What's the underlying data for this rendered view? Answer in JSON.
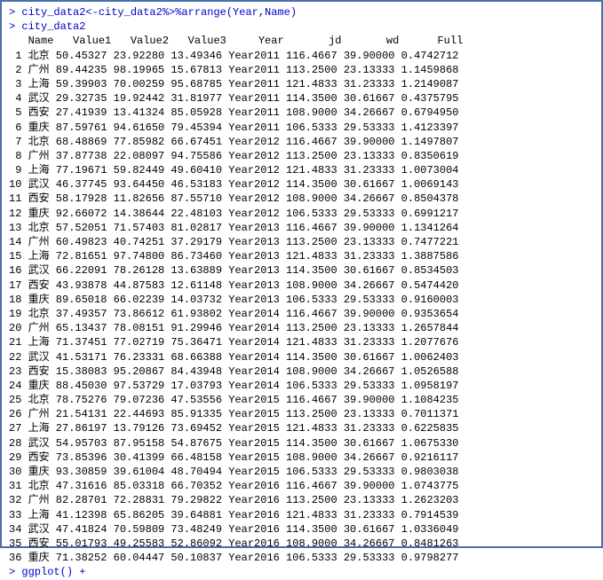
{
  "console": {
    "prompt": "> ",
    "line1": "city_data2<-city_data2%>%arrange(Year,Name)",
    "line2": "city_data2",
    "line3": "ggplot() +"
  },
  "chart_data": {
    "type": "table",
    "columns": [
      "Name",
      "Value1",
      "Value2",
      "Value3",
      "Year",
      "jd",
      "wd",
      "Full"
    ],
    "rows": [
      {
        "idx": 1,
        "Name": "北京",
        "Value1": "50.45327",
        "Value2": "23.92280",
        "Value3": "13.49346",
        "Year": "Year2011",
        "jd": "116.4667",
        "wd": "39.90000",
        "Full": "0.4742712"
      },
      {
        "idx": 2,
        "Name": "广州",
        "Value1": "89.44235",
        "Value2": "98.19965",
        "Value3": "15.67813",
        "Year": "Year2011",
        "jd": "113.2500",
        "wd": "23.13333",
        "Full": "1.1459868"
      },
      {
        "idx": 3,
        "Name": "上海",
        "Value1": "59.39903",
        "Value2": "70.00259",
        "Value3": "95.68785",
        "Year": "Year2011",
        "jd": "121.4833",
        "wd": "31.23333",
        "Full": "1.2149087"
      },
      {
        "idx": 4,
        "Name": "武汉",
        "Value1": "29.32735",
        "Value2": "19.92442",
        "Value3": "31.81977",
        "Year": "Year2011",
        "jd": "114.3500",
        "wd": "30.61667",
        "Full": "0.4375795"
      },
      {
        "idx": 5,
        "Name": "西安",
        "Value1": "27.41939",
        "Value2": "13.41324",
        "Value3": "85.05928",
        "Year": "Year2011",
        "jd": "108.9000",
        "wd": "34.26667",
        "Full": "0.6794950"
      },
      {
        "idx": 6,
        "Name": "重庆",
        "Value1": "87.59761",
        "Value2": "94.61650",
        "Value3": "79.45394",
        "Year": "Year2011",
        "jd": "106.5333",
        "wd": "29.53333",
        "Full": "1.4123397"
      },
      {
        "idx": 7,
        "Name": "北京",
        "Value1": "68.48869",
        "Value2": "77.85982",
        "Value3": "66.67451",
        "Year": "Year2012",
        "jd": "116.4667",
        "wd": "39.90000",
        "Full": "1.1497807"
      },
      {
        "idx": 8,
        "Name": "广州",
        "Value1": "37.87738",
        "Value2": "22.08097",
        "Value3": "94.75586",
        "Year": "Year2012",
        "jd": "113.2500",
        "wd": "23.13333",
        "Full": "0.8350619"
      },
      {
        "idx": 9,
        "Name": "上海",
        "Value1": "77.19671",
        "Value2": "59.82449",
        "Value3": "49.60410",
        "Year": "Year2012",
        "jd": "121.4833",
        "wd": "31.23333",
        "Full": "1.0073004"
      },
      {
        "idx": 10,
        "Name": "武汉",
        "Value1": "46.37745",
        "Value2": "93.64450",
        "Value3": "46.53183",
        "Year": "Year2012",
        "jd": "114.3500",
        "wd": "30.61667",
        "Full": "1.0069143"
      },
      {
        "idx": 11,
        "Name": "西安",
        "Value1": "58.17928",
        "Value2": "11.82656",
        "Value3": "87.55710",
        "Year": "Year2012",
        "jd": "108.9000",
        "wd": "34.26667",
        "Full": "0.8504378"
      },
      {
        "idx": 12,
        "Name": "重庆",
        "Value1": "92.66072",
        "Value2": "14.38644",
        "Value3": "22.48103",
        "Year": "Year2012",
        "jd": "106.5333",
        "wd": "29.53333",
        "Full": "0.6991217"
      },
      {
        "idx": 13,
        "Name": "北京",
        "Value1": "57.52051",
        "Value2": "71.57403",
        "Value3": "81.02817",
        "Year": "Year2013",
        "jd": "116.4667",
        "wd": "39.90000",
        "Full": "1.1341264"
      },
      {
        "idx": 14,
        "Name": "广州",
        "Value1": "60.49823",
        "Value2": "40.74251",
        "Value3": "37.29179",
        "Year": "Year2013",
        "jd": "113.2500",
        "wd": "23.13333",
        "Full": "0.7477221"
      },
      {
        "idx": 15,
        "Name": "上海",
        "Value1": "72.81651",
        "Value2": "97.74800",
        "Value3": "86.73460",
        "Year": "Year2013",
        "jd": "121.4833",
        "wd": "31.23333",
        "Full": "1.3887586"
      },
      {
        "idx": 16,
        "Name": "武汉",
        "Value1": "66.22091",
        "Value2": "78.26128",
        "Value3": "13.63889",
        "Year": "Year2013",
        "jd": "114.3500",
        "wd": "30.61667",
        "Full": "0.8534503"
      },
      {
        "idx": 17,
        "Name": "西安",
        "Value1": "43.93878",
        "Value2": "44.87583",
        "Value3": "12.61148",
        "Year": "Year2013",
        "jd": "108.9000",
        "wd": "34.26667",
        "Full": "0.5474420"
      },
      {
        "idx": 18,
        "Name": "重庆",
        "Value1": "89.65018",
        "Value2": "66.02239",
        "Value3": "14.03732",
        "Year": "Year2013",
        "jd": "106.5333",
        "wd": "29.53333",
        "Full": "0.9160003"
      },
      {
        "idx": 19,
        "Name": "北京",
        "Value1": "37.49357",
        "Value2": "73.86612",
        "Value3": "61.93802",
        "Year": "Year2014",
        "jd": "116.4667",
        "wd": "39.90000",
        "Full": "0.9353654"
      },
      {
        "idx": 20,
        "Name": "广州",
        "Value1": "65.13437",
        "Value2": "78.08151",
        "Value3": "91.29946",
        "Year": "Year2014",
        "jd": "113.2500",
        "wd": "23.13333",
        "Full": "1.2657844"
      },
      {
        "idx": 21,
        "Name": "上海",
        "Value1": "71.37451",
        "Value2": "77.02719",
        "Value3": "75.36471",
        "Year": "Year2014",
        "jd": "121.4833",
        "wd": "31.23333",
        "Full": "1.2077676"
      },
      {
        "idx": 22,
        "Name": "武汉",
        "Value1": "41.53171",
        "Value2": "76.23331",
        "Value3": "68.66388",
        "Year": "Year2014",
        "jd": "114.3500",
        "wd": "30.61667",
        "Full": "1.0062403"
      },
      {
        "idx": 23,
        "Name": "西安",
        "Value1": "15.38083",
        "Value2": "95.20867",
        "Value3": "84.43948",
        "Year": "Year2014",
        "jd": "108.9000",
        "wd": "34.26667",
        "Full": "1.0526588"
      },
      {
        "idx": 24,
        "Name": "重庆",
        "Value1": "88.45030",
        "Value2": "97.53729",
        "Value3": "17.03793",
        "Year": "Year2014",
        "jd": "106.5333",
        "wd": "29.53333",
        "Full": "1.0958197"
      },
      {
        "idx": 25,
        "Name": "北京",
        "Value1": "78.75276",
        "Value2": "79.07236",
        "Value3": "47.53556",
        "Year": "Year2015",
        "jd": "116.4667",
        "wd": "39.90000",
        "Full": "1.1084235"
      },
      {
        "idx": 26,
        "Name": "广州",
        "Value1": "21.54131",
        "Value2": "22.44693",
        "Value3": "85.91335",
        "Year": "Year2015",
        "jd": "113.2500",
        "wd": "23.13333",
        "Full": "0.7011371"
      },
      {
        "idx": 27,
        "Name": "上海",
        "Value1": "27.86197",
        "Value2": "13.79126",
        "Value3": "73.69452",
        "Year": "Year2015",
        "jd": "121.4833",
        "wd": "31.23333",
        "Full": "0.6225835"
      },
      {
        "idx": 28,
        "Name": "武汉",
        "Value1": "54.95703",
        "Value2": "87.95158",
        "Value3": "54.87675",
        "Year": "Year2015",
        "jd": "114.3500",
        "wd": "30.61667",
        "Full": "1.0675330"
      },
      {
        "idx": 29,
        "Name": "西安",
        "Value1": "73.85396",
        "Value2": "30.41399",
        "Value3": "66.48158",
        "Year": "Year2015",
        "jd": "108.9000",
        "wd": "34.26667",
        "Full": "0.9216117"
      },
      {
        "idx": 30,
        "Name": "重庆",
        "Value1": "93.30859",
        "Value2": "39.61004",
        "Value3": "48.70494",
        "Year": "Year2015",
        "jd": "106.5333",
        "wd": "29.53333",
        "Full": "0.9803038"
      },
      {
        "idx": 31,
        "Name": "北京",
        "Value1": "47.31616",
        "Value2": "85.03318",
        "Value3": "66.70352",
        "Year": "Year2016",
        "jd": "116.4667",
        "wd": "39.90000",
        "Full": "1.0743775"
      },
      {
        "idx": 32,
        "Name": "广州",
        "Value1": "82.28701",
        "Value2": "72.28831",
        "Value3": "79.29822",
        "Year": "Year2016",
        "jd": "113.2500",
        "wd": "23.13333",
        "Full": "1.2623203"
      },
      {
        "idx": 33,
        "Name": "上海",
        "Value1": "41.12398",
        "Value2": "65.86205",
        "Value3": "39.64881",
        "Year": "Year2016",
        "jd": "121.4833",
        "wd": "31.23333",
        "Full": "0.7914539"
      },
      {
        "idx": 34,
        "Name": "武汉",
        "Value1": "47.41824",
        "Value2": "70.59809",
        "Value3": "73.48249",
        "Year": "Year2016",
        "jd": "114.3500",
        "wd": "30.61667",
        "Full": "1.0336049"
      },
      {
        "idx": 35,
        "Name": "西安",
        "Value1": "55.01793",
        "Value2": "49.25583",
        "Value3": "52.86092",
        "Year": "Year2016",
        "jd": "108.9000",
        "wd": "34.26667",
        "Full": "0.8481263"
      },
      {
        "idx": 36,
        "Name": "重庆",
        "Value1": "71.38252",
        "Value2": "60.04447",
        "Value3": "50.10837",
        "Year": "Year2016",
        "jd": "106.5333",
        "wd": "29.53333",
        "Full": "0.9798277"
      }
    ]
  }
}
